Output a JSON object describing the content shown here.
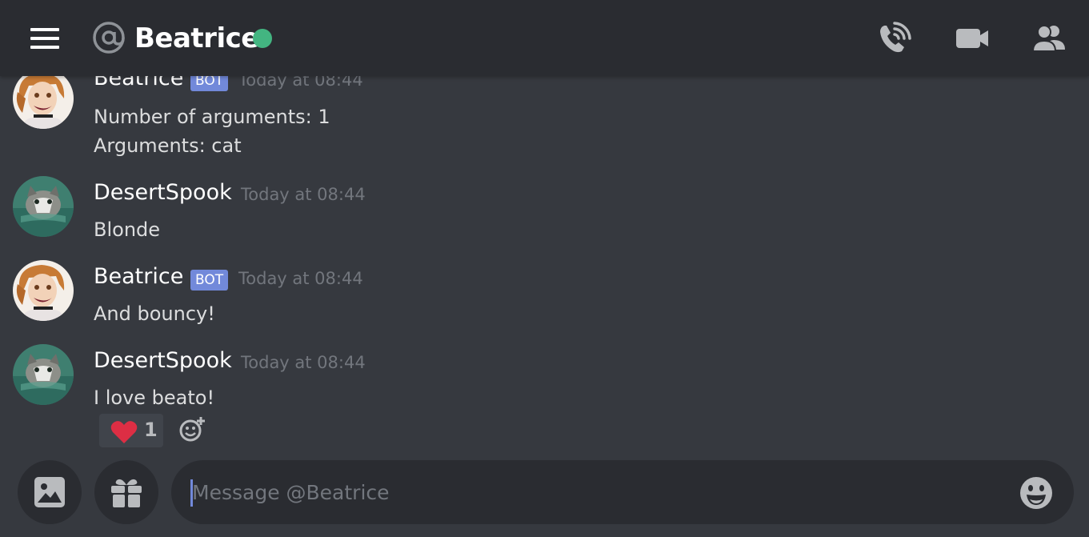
{
  "header": {
    "menu_icon": "hamburger-icon",
    "channel_icon": "at-icon",
    "channel_name": "Beatrice",
    "status": "online",
    "status_color": "#43b581",
    "actions": [
      {
        "icon": "voice-call-icon"
      },
      {
        "icon": "video-call-icon"
      },
      {
        "icon": "members-icon"
      }
    ]
  },
  "messages": [
    {
      "author": "Beatrice",
      "bot_tag": "BOT",
      "timestamp": "Today at 08:44",
      "lines": [
        "Number of arguments: 1",
        "Arguments: cat"
      ]
    },
    {
      "author": "DesertSpook",
      "timestamp": "Today at 08:44",
      "lines": [
        "Blonde"
      ]
    },
    {
      "author": "Beatrice",
      "bot_tag": "BOT",
      "timestamp": "Today at 08:44",
      "lines": [
        "And bouncy!"
      ]
    },
    {
      "author": "DesertSpook",
      "timestamp": "Today at 08:44",
      "lines": [
        "I love beato!"
      ],
      "reaction": {
        "emoji": "heart-icon",
        "count": "1"
      }
    }
  ],
  "composer": {
    "image_button_icon": "image-icon",
    "gift_button_icon": "gift-icon",
    "placeholder": "Message @Beatrice",
    "value": "",
    "emoji_button_icon": "smile-emoji-icon"
  },
  "colors": {
    "background": "#36393f",
    "header": "#2a2c31",
    "bot_tag": "#7289da",
    "timestamp": "#72767d"
  }
}
